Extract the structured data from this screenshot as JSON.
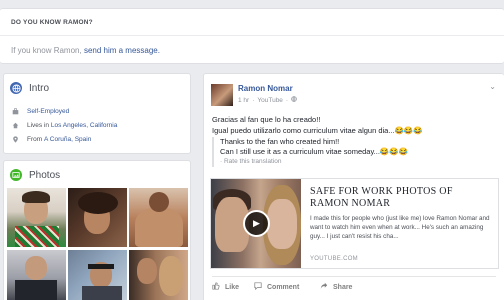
{
  "know": {
    "title": "DO YOU KNOW RAMON?",
    "text_prefix": "If you know Ramon,",
    "link": "send him a message."
  },
  "intro": {
    "title": "Intro",
    "icon": "globe-icon",
    "items": [
      {
        "icon": "briefcase-icon",
        "prefix": "",
        "link": "Self-Employed"
      },
      {
        "icon": "home-icon",
        "prefix": "Lives in",
        "link": "Los Angeles, California"
      },
      {
        "icon": "location-pin-icon",
        "prefix": "From",
        "link": "A Coruña, Spain"
      }
    ]
  },
  "photos": {
    "title": "Photos",
    "icon": "photo-icon"
  },
  "post": {
    "author": "Ramon Nomar",
    "time": "1 hr",
    "source": "YouTube",
    "privacy_icon": "globe-icon",
    "line1": "Gracias al fan que lo ha creado!!",
    "line2": "Igual puedo utilizarlo como curriculum vitae algun dia...😂😂😂",
    "translation_line1": "Thanks to the fan who created him!!",
    "translation_line2": "Can I still use it as a curriculum vitae someday...😂😂😂",
    "rate_translation": "Rate this translation",
    "link_title": "SAFE FOR WORK PHOTOS OF RAMON NOMAR",
    "link_desc": "I made this for people who (just like me) love Ramon Nomar and want to watch him even when at work... He's such an amazing guy... I just can't resist his cha...",
    "link_domain": "YOUTUBE.COM",
    "actions": {
      "like": "Like",
      "comment": "Comment",
      "share": "Share"
    }
  },
  "colors": {
    "link": "#365899",
    "bg": "#e9ebee",
    "muted": "#90949c"
  }
}
